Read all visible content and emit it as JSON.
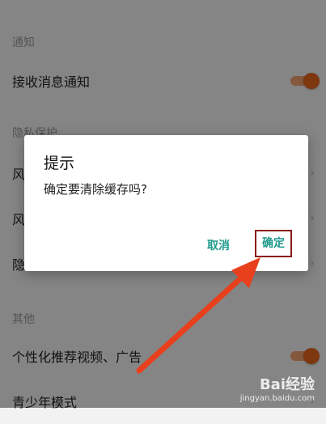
{
  "settings": {
    "sections": [
      {
        "header": "通知"
      },
      {
        "header": "隐私保护"
      },
      {
        "header": "其他"
      }
    ],
    "rows": [
      {
        "label": "接收消息通知",
        "control": "toggle",
        "on": true
      },
      {
        "label": "风",
        "control": "chevron"
      },
      {
        "label": "风",
        "control": "chevron"
      },
      {
        "label": "隐",
        "control": "chevron"
      },
      {
        "label": "个性化推荐视频、广告",
        "control": "toggle",
        "on": true
      },
      {
        "label": "青少年模式",
        "control": "chevron"
      }
    ]
  },
  "dialog": {
    "title": "提示",
    "message": "确定要清除缓存吗?",
    "cancel_label": "取消",
    "confirm_label": "确定"
  },
  "watermark": {
    "logo_text": "Bai经验",
    "sub_text": "jingyan.baidu.com"
  },
  "colors": {
    "accent": "#e8641e",
    "dialog_button": "#1e9a8c",
    "highlight_box": "#8b1a1a",
    "arrow": "#e8401c"
  }
}
